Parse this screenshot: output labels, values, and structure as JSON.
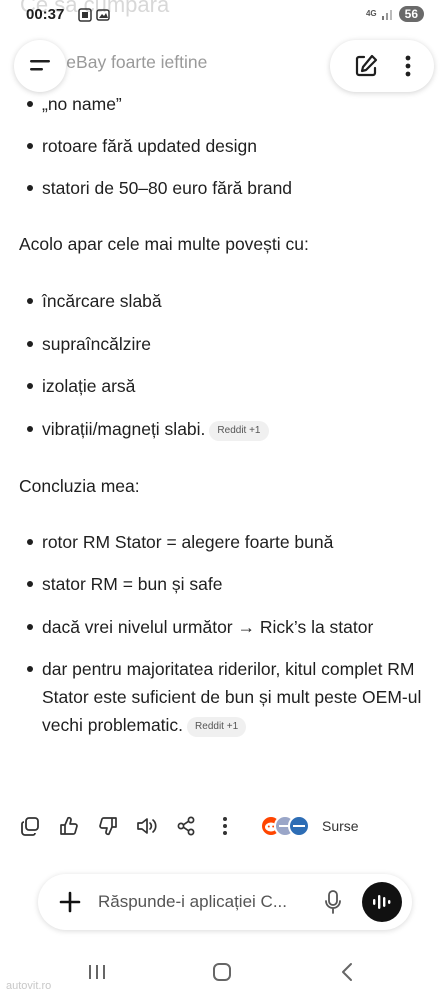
{
  "status_bar": {
    "time": "00:37",
    "network": "4G",
    "battery": "56",
    "ghost_text": "Ce să cumpara"
  },
  "content": {
    "partial_line": "uri eBay foarte ieftine",
    "group1": [
      "„no name”",
      "rotoare fără updated design",
      "statori de 50–80 euro fără brand"
    ],
    "para1": "Acolo apar cele mai multe povești cu:",
    "group2": [
      "încărcare slabă",
      "supraîncălzire",
      "izolație arsă"
    ],
    "group2_last": "vibrații/magneți slabi.",
    "chip1": "Reddit +1",
    "para2": "Concluzia mea:",
    "group3": [
      "rotor RM Stator = alegere foarte bună",
      "stator RM = bun și safe",
      "dacă vrei nivelul următor → Rick’s la stator"
    ],
    "group3_last": "dar pentru majoritatea riderilor, kitul complet RM Stator este suficient de bun și mult peste OEM-ul vechi problematic.",
    "chip2": "Reddit +1"
  },
  "actions": {
    "icons": [
      "copy-icon",
      "thumbs-up-icon",
      "thumbs-down-icon",
      "read-aloud-icon",
      "share-icon",
      "more-vertical-icon"
    ],
    "sources_label": "Surse"
  },
  "input": {
    "placeholder": "Răspunde-i aplicației C..."
  },
  "watermark": "autovit.ro",
  "colors": {
    "text": "#1f1f1f",
    "chip_bg": "#f0f0f0",
    "voice_button": "#111111",
    "reddit": "#ff4500"
  }
}
